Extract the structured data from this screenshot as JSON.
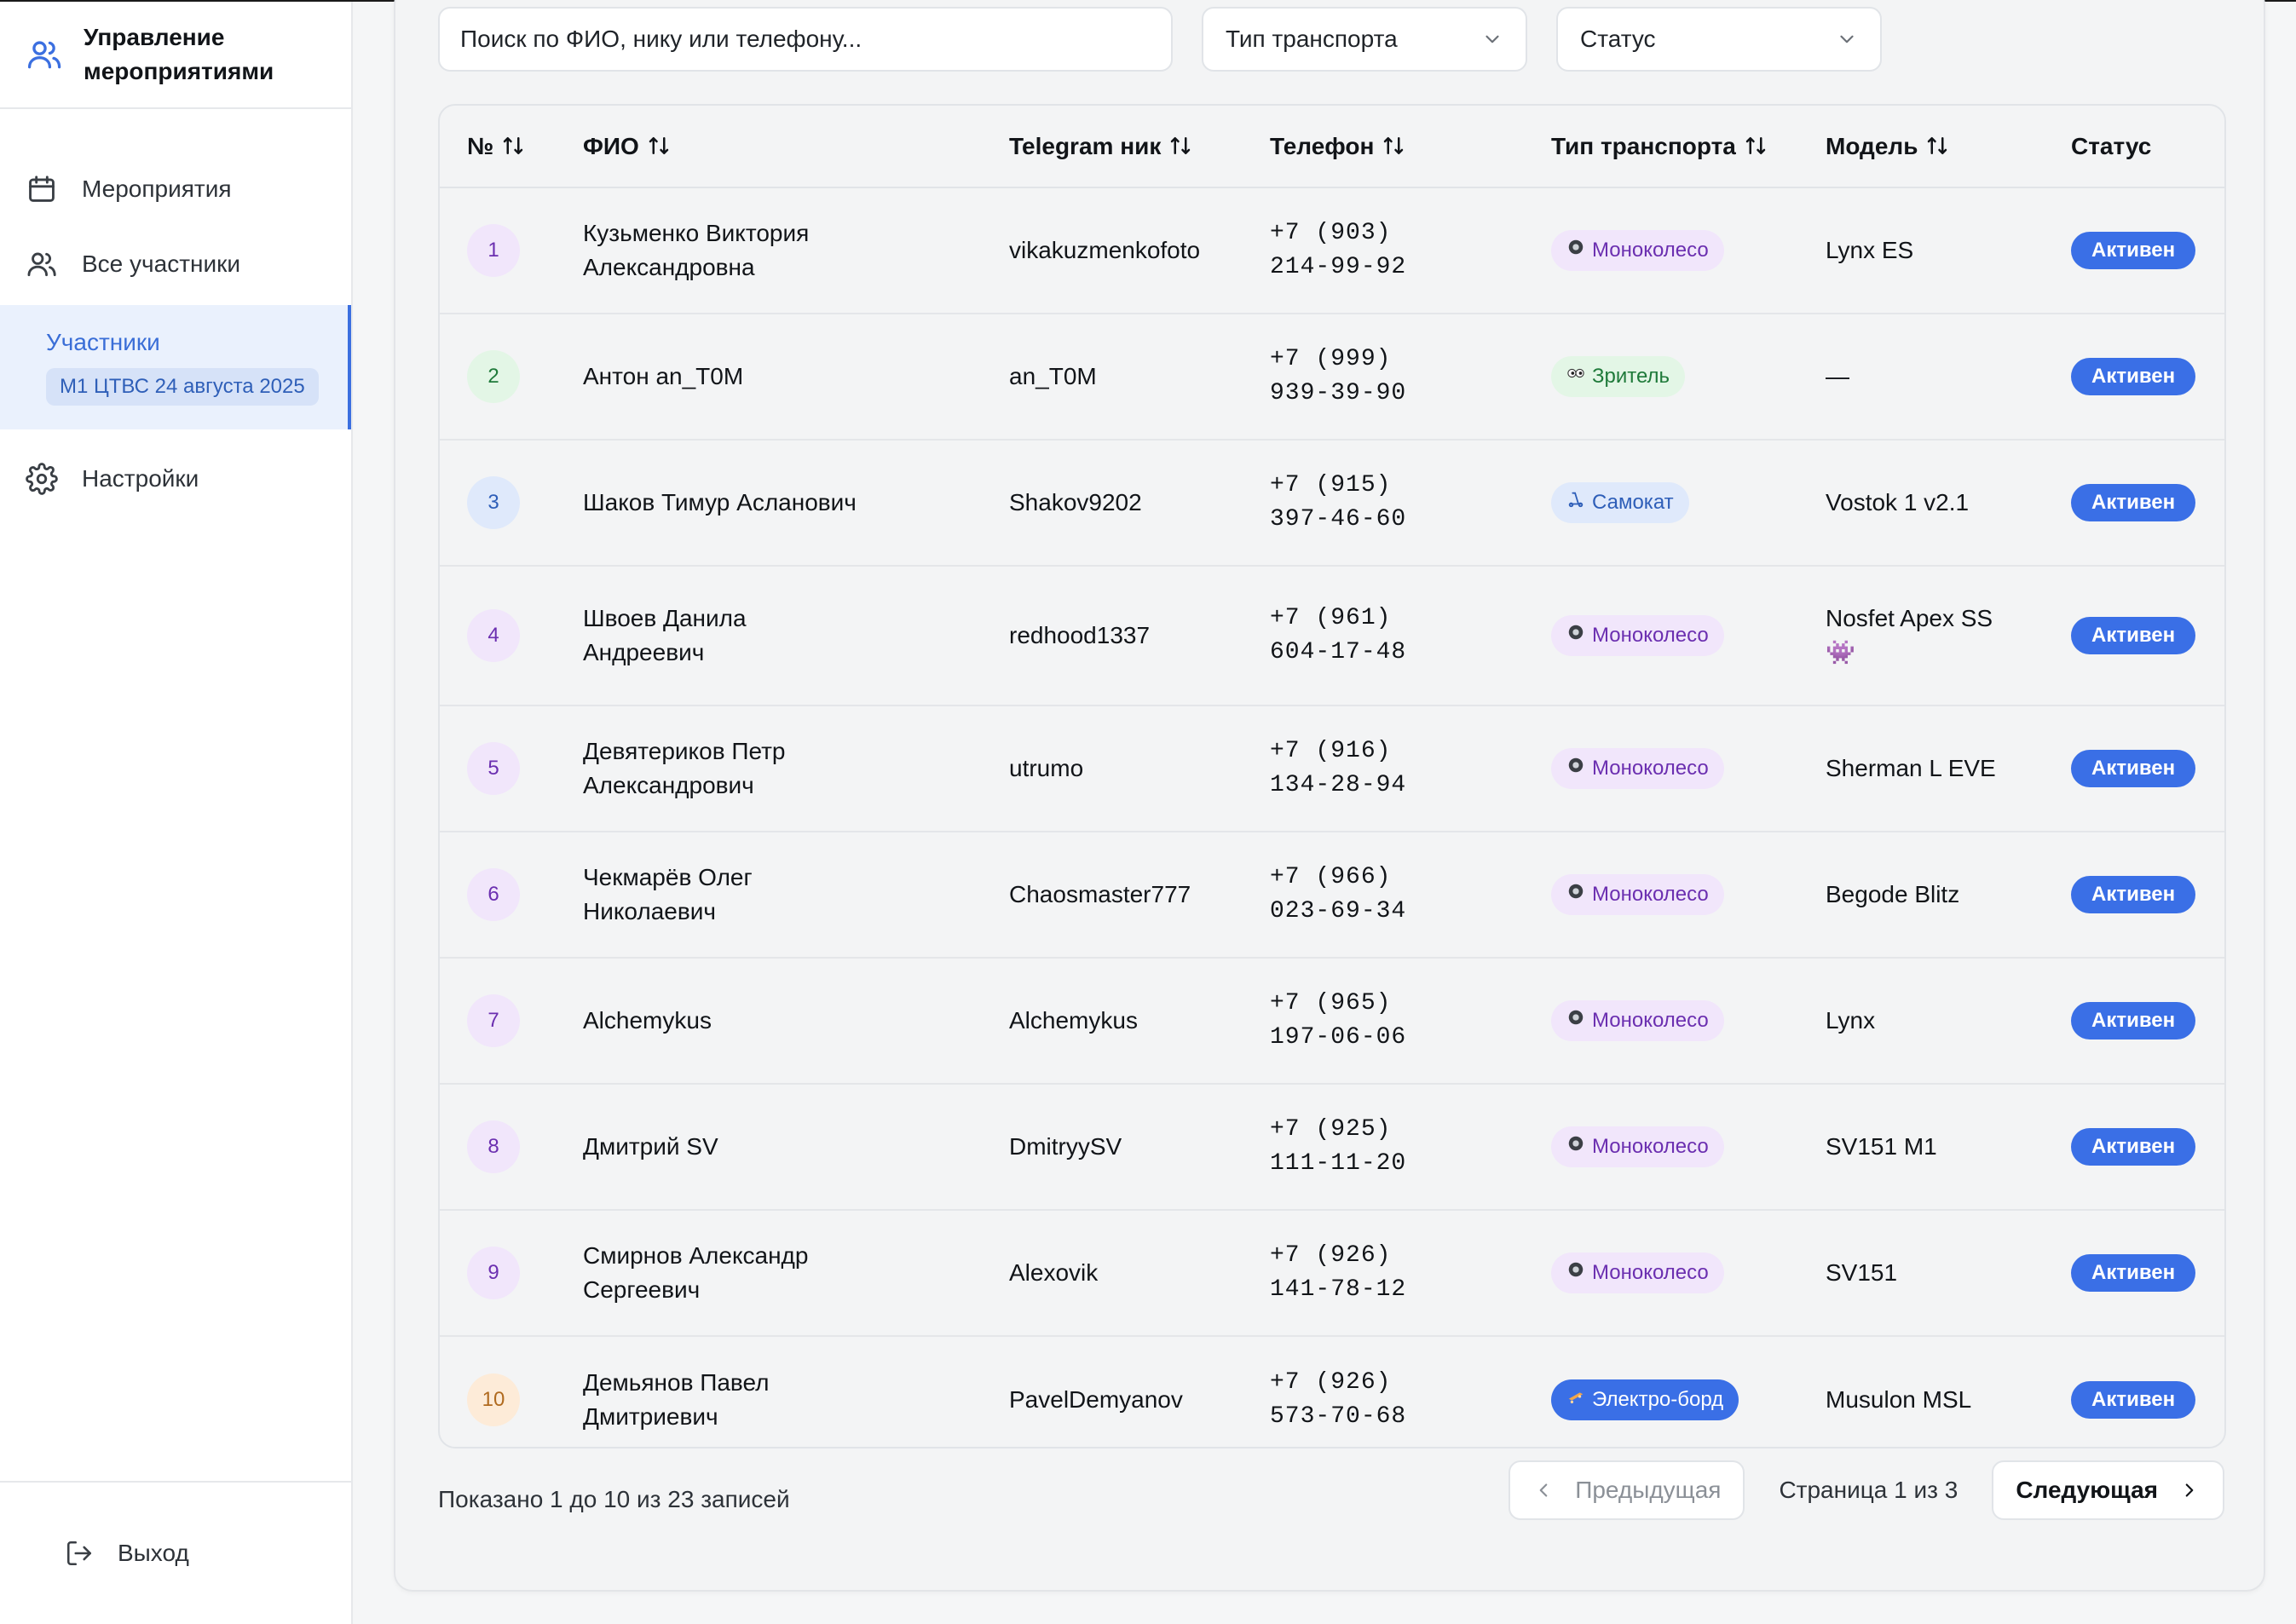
{
  "app": {
    "title": "Управление мероприятиями"
  },
  "sidebar": {
    "items": [
      {
        "label": "Мероприятия",
        "icon": "calendar-icon"
      },
      {
        "label": "Все участники",
        "icon": "users-icon"
      }
    ],
    "active": {
      "label": "Участники",
      "badge": "М1 ЦТВС 24 августа 2025"
    },
    "settings": {
      "label": "Настройки",
      "icon": "gear-icon"
    },
    "logout": {
      "label": "Выход",
      "icon": "logout-icon"
    }
  },
  "filters": {
    "search_placeholder": "Поиск по ФИО, нику или телефону...",
    "transport_select": "Тип транспорта",
    "status_select": "Статус"
  },
  "table": {
    "columns": [
      "№",
      "ФИО",
      "Telegram ник",
      "Телефон",
      "Тип транспорта",
      "Модель",
      "Статус"
    ],
    "rows": [
      {
        "num": "1",
        "name": "Кузьменко Виктория Александровна",
        "nick": "vikakuzmenkofoto",
        "phone": "+7 (903) 214-99-92",
        "transport": "Моноколесо",
        "transport_kind": "mono",
        "model": "Lynx ES",
        "status": "Активен"
      },
      {
        "num": "2",
        "name": "Антон an_T0M",
        "nick": "an_T0M",
        "phone": "+7 (999) 939-39-90",
        "transport": "Зритель",
        "transport_kind": "viewer",
        "model": "—",
        "status": "Активен"
      },
      {
        "num": "3",
        "name": "Шаков Тимур Асланович",
        "nick": "Shakov9202",
        "phone": "+7 (915) 397-46-60",
        "transport": "Самокат",
        "transport_kind": "scooter",
        "model": "Vostok 1 v2.1",
        "status": "Активен"
      },
      {
        "num": "4",
        "name": "Швоев Данила Андреевич",
        "nick": "redhood1337",
        "phone": "+7 (961) 604-17-48",
        "transport": "Моноколесо",
        "transport_kind": "mono",
        "model": "Nosfet Apex SS 👾",
        "status": "Активен"
      },
      {
        "num": "5",
        "name": "Девятериков Петр Александрович",
        "nick": "utrumo",
        "phone": "+7 (916) 134-28-94",
        "transport": "Моноколесо",
        "transport_kind": "mono",
        "model": "Sherman L EVE",
        "status": "Активен"
      },
      {
        "num": "6",
        "name": "Чекмарёв Олег Николаевич",
        "nick": "Chaosmaster777",
        "phone": "+7 (966) 023-69-34",
        "transport": "Моноколесо",
        "transport_kind": "mono",
        "model": "Begode Blitz",
        "status": "Активен"
      },
      {
        "num": "7",
        "name": "Alchemykus",
        "nick": "Alchemykus",
        "phone": "+7 (965) 197-06-06",
        "transport": "Моноколесо",
        "transport_kind": "mono",
        "model": "Lynx",
        "status": "Активен"
      },
      {
        "num": "8",
        "name": "Дмитрий SV",
        "nick": "DmitryySV",
        "phone": "+7 (925) 111-11-20",
        "transport": "Моноколесо",
        "transport_kind": "mono",
        "model": "SV151 M1",
        "status": "Активен"
      },
      {
        "num": "9",
        "name": "Смирнов Александр Сергеевич",
        "nick": "Alexovik",
        "phone": "+7 (926) 141-78-12",
        "transport": "Моноколесо",
        "transport_kind": "mono",
        "model": "SV151",
        "status": "Активен"
      },
      {
        "num": "10",
        "name": "Демьянов Павел Дмитриевич",
        "nick": "PavelDemyanov",
        "phone": "+7 (926) 573-70-68",
        "transport": "Электро-борд",
        "transport_kind": "board",
        "model": "Musulon MSL",
        "status": "Активен"
      }
    ]
  },
  "footer": {
    "shown": "Показано 1 до 10 из 23 записей",
    "prev": "Предыдущая",
    "page": "Страница 1 из 3",
    "next": "Следующая"
  },
  "colors": {
    "accent": "#3a6fe6",
    "mono_bg": "#f1e6fb",
    "mono_fg": "#6b2fb0",
    "viewer_bg": "#e3f6e6",
    "viewer_fg": "#1f7a3a",
    "scooter_bg": "#dfe9fb",
    "scooter_fg": "#2e5eb8",
    "board_bg": "#3a6fe6",
    "board_fg": "#ffffff"
  }
}
